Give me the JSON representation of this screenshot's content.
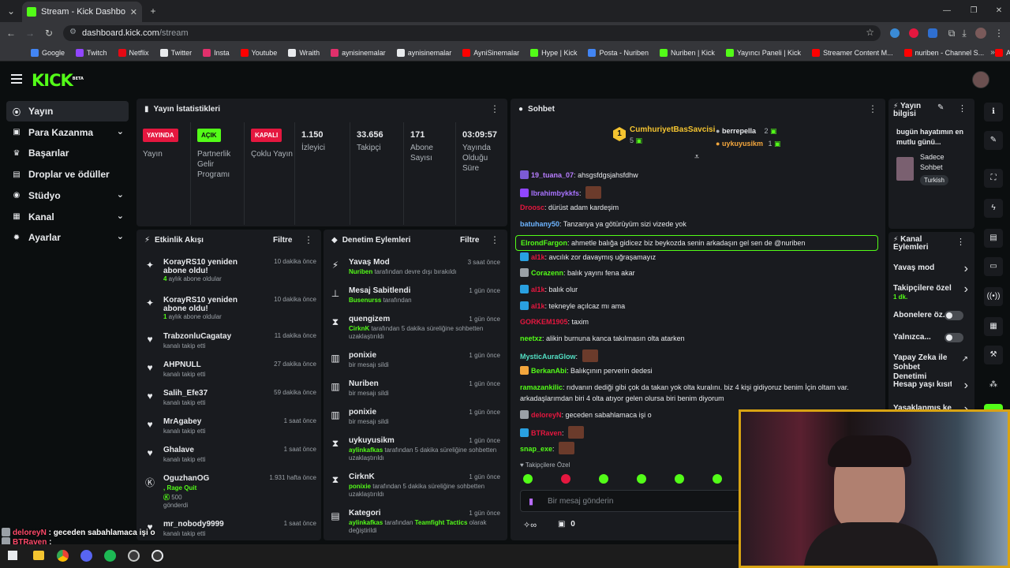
{
  "browser": {
    "tab_title": "Stream - Kick Dashboard",
    "url_host": "dashboard.kick.com",
    "url_path": "/stream",
    "bookmarks": [
      {
        "label": "Google",
        "color": "#4285f4"
      },
      {
        "label": "Twitch",
        "color": "#9146ff"
      },
      {
        "label": "Netflix",
        "color": "#e50914"
      },
      {
        "label": "Twitter",
        "color": "#e8eaed"
      },
      {
        "label": "Insta",
        "color": "#e1306c"
      },
      {
        "label": "Youtube",
        "color": "#ff0000"
      },
      {
        "label": "Wraith",
        "color": "#e8eaed"
      },
      {
        "label": "aynisinemalar",
        "color": "#e1306c"
      },
      {
        "label": "aynisinemalar",
        "color": "#e8eaed"
      },
      {
        "label": "AyniSinemalar",
        "color": "#ff0000"
      },
      {
        "label": "Hype | Kick",
        "color": "#53fc18"
      },
      {
        "label": "Posta - Nuriben",
        "color": "#4285f4"
      },
      {
        "label": "Nuriben | Kick",
        "color": "#53fc18"
      },
      {
        "label": "Yayıncı Paneli | Kick",
        "color": "#53fc18"
      },
      {
        "label": "Streamer Content M...",
        "color": "#ff0000"
      },
      {
        "label": "nuriben - Channel S...",
        "color": "#ff0000"
      },
      {
        "label": "Aynı Sinemalar - Ça...",
        "color": "#ff0000"
      }
    ]
  },
  "brand": {
    "logo": "KICK",
    "beta": "BETA",
    "accent": "#53fc18"
  },
  "sidebar": {
    "items": [
      {
        "label": "Yayın",
        "icon": "broadcast-icon",
        "active": true
      },
      {
        "label": "Para Kazanma",
        "icon": "money-icon",
        "chevron": true
      },
      {
        "label": "Başarılar",
        "icon": "trophy-icon"
      },
      {
        "label": "Droplar ve ödüller",
        "icon": "gift-icon"
      },
      {
        "label": "Stüdyo",
        "icon": "studio-icon",
        "chevron": true
      },
      {
        "label": "Kanal",
        "icon": "channel-icon",
        "chevron": true
      },
      {
        "label": "Ayarlar",
        "icon": "gear-icon",
        "chevron": true
      }
    ]
  },
  "stats": {
    "title": "Yayın İstatistikleri",
    "badges": [
      {
        "badge": "YAYINDA",
        "label": "Yayın",
        "bg": "#e5173f",
        "fg": "#ffffff"
      },
      {
        "badge": "AÇIK",
        "label": "Partnerlik Gelir Programı",
        "bg": "#53fc18",
        "fg": "#0b0e0f"
      },
      {
        "badge": "KAPALI",
        "label": "Çoklu Yayın",
        "bg": "#e5173f",
        "fg": "#ffffff"
      }
    ],
    "values": [
      {
        "value": "1.150",
        "label": "İzleyici"
      },
      {
        "value": "33.656",
        "label": "Takipçi"
      },
      {
        "value": "171",
        "label": "Abone Sayısı"
      },
      {
        "value": "03:09:57",
        "label": "Yayında Olduğu Süre"
      }
    ]
  },
  "activity": {
    "title": "Etkinlik Akışı",
    "filter": "Filtre",
    "items": [
      {
        "name": "KorayRS10 yeniden abone oldu!",
        "time": "10 dakika önce",
        "sub_num": "4",
        "sub": " aylık abone oldular",
        "icon": "sparkle-icon"
      },
      {
        "name": "KorayRS10 yeniden abone oldu!",
        "time": "10 dakika önce",
        "sub_num": "1",
        "sub": " aylık abone oldular",
        "icon": "sparkle-icon"
      },
      {
        "name": "TrabzonluCagatay",
        "time": "11 dakika önce",
        "sub": "kanalı takip etti",
        "icon": "heart-icon"
      },
      {
        "name": "AHPNULL",
        "time": "27 dakika önce",
        "sub": "kanalı takip etti",
        "icon": "heart-icon"
      },
      {
        "name": "Salih_Efe37",
        "time": "59 dakika önce",
        "sub": "kanalı takip etti",
        "icon": "heart-icon"
      },
      {
        "name": "MrAgabey",
        "time": "1 saat önce",
        "sub": "kanalı takip etti",
        "icon": "heart-icon"
      },
      {
        "name": "Ghalave",
        "time": "1 saat önce",
        "sub": "kanalı takip etti",
        "icon": "heart-icon"
      },
      {
        "name": "OguzhanOG",
        "time": "1.931 hafta önce",
        "sub_green": ", Rage Quit",
        "amount": "500",
        "sub2": "gönderdi",
        "icon": "kick-coin-icon"
      },
      {
        "name": "mr_nobody9999",
        "time": "1 saat önce",
        "sub": "kanalı takip etti",
        "icon": "heart-icon"
      }
    ]
  },
  "modlog": {
    "title": "Denetim Eylemleri",
    "filter": "Filtre",
    "items": [
      {
        "name": "Yavaş Mod",
        "time": "3 saat önce",
        "actor": "Nuriben",
        "desc": " tarafından devre dışı bırakıldı",
        "icon": "slow-icon"
      },
      {
        "name": "Mesaj Sabitlendi",
        "time": "1 gün önce",
        "actor": "Busenurss",
        "desc": " tarafından",
        "icon": "pin-icon"
      },
      {
        "name": "quengizem",
        "time": "1 gün önce",
        "actor": "CirknK",
        "desc": " tarafından 5 dakika süreliğine sohbetten uzaklaştırıldı",
        "icon": "hourglass-icon"
      },
      {
        "name": "ponixie",
        "time": "1 gün önce",
        "actor": "",
        "desc": "bir mesajı sildi",
        "icon": "trash-icon"
      },
      {
        "name": "Nuriben",
        "time": "1 gün önce",
        "actor": "",
        "desc": "bir mesajı sildi",
        "icon": "trash-icon"
      },
      {
        "name": "ponixie",
        "time": "1 gün önce",
        "actor": "",
        "desc": "bir mesajı sildi",
        "icon": "trash-icon"
      },
      {
        "name": "uykuyusikm",
        "time": "1 gün önce",
        "actor": "aylinkafkas",
        "desc": " tarafından 5 dakika süreliğine sohbetten uzaklaştırıldı",
        "icon": "hourglass-icon"
      },
      {
        "name": "CirknK",
        "time": "1 gün önce",
        "actor": "ponixie",
        "desc": " tarafından 5 dakika süreliğine sohbetten uzaklaştırıldı",
        "icon": "hourglass-icon"
      },
      {
        "name": "Kategori",
        "time": "1 gün önce",
        "actor": "aylinkafkas",
        "desc": " tarafından ",
        "highlight": "Teamfight Tactics",
        "desc2": " olarak değiştirildi",
        "icon": "category-icon"
      }
    ]
  },
  "chat": {
    "title": "Sohbet",
    "top_gifter": {
      "rank": "1",
      "name": "CumhuriyetBasSavcisi",
      "count": "5"
    },
    "gifters": [
      {
        "name": "berrepella",
        "count": "2",
        "color": "#e8eaed"
      },
      {
        "name": "uykuyusikm",
        "count": "1",
        "color": "#f4a73d"
      }
    ],
    "messages": [
      {
        "user": "19_tuana_07",
        "color": "#b87dff",
        "badge": "#7b5bd6",
        "text": "ahsgsfdgsjahsfdhw"
      },
      {
        "user": "Ibrahimbykkfs",
        "color": "#a873ff",
        "badge": "#9146ff",
        "text": "",
        "emote": true
      },
      {
        "user": "Droosc",
        "color": "#e5173f",
        "text": "dürüst adam kardeşim"
      },
      {
        "user": "batuhany50",
        "color": "#6db4ff",
        "text": "Tanzanya ya götürüyüm sizi vizede yok"
      },
      {
        "user": "ElrondFargon",
        "color": "#53fc18",
        "text": "ahmetle balığa gidicez biz beykozda senin arkadaşın gel sen de @nuriben",
        "pinned": true
      },
      {
        "user": "al1k",
        "color": "#e5173f",
        "badge": "#29a0e0",
        "text": "avcılık zor davaymış uğraşamayız"
      },
      {
        "user": "Corazenn",
        "color": "#53fc18",
        "badge": "#9aa0a6",
        "text": "balık yayını fena akar"
      },
      {
        "user": "al1k",
        "color": "#e5173f",
        "badge": "#29a0e0",
        "text": "balık olur"
      },
      {
        "user": "al1k",
        "color": "#e5173f",
        "badge": "#29a0e0",
        "text": "tekneyle açılcaz mı ama"
      },
      {
        "user": "GORKEM1905",
        "color": "#e5173f",
        "text": "taxim"
      },
      {
        "user": "neetxz",
        "color": "#53fc18",
        "text": "alikin burnuna kanca takılmasın olta atarken"
      },
      {
        "user": "MysticAuraGlow",
        "color": "#53e0c5",
        "text": "",
        "emote": true
      },
      {
        "user": "BerkanAbi",
        "color": "#53fc18",
        "badge": "#f4a73d",
        "text": "Balıkçının perverin dedesi"
      },
      {
        "user": "ramazankilic",
        "color": "#53fc18",
        "text": "rıdvanın dediği gibi çok da takan yok olta kuralını. biz 4 kişi gidiyoruz benim İçin oltam var."
      },
      {
        "user": "",
        "color": "#e8eaed",
        "text": "arkadaşlarımdan biri 4 olta atıyor gelen olursa biri benim diyorum"
      },
      {
        "user": "deloreyN",
        "color": "#e5173f",
        "badge": "#9aa0a6",
        "text": "geceden sabahlamaca işi o"
      },
      {
        "user": "BTRaven",
        "color": "#e5173f",
        "badge": "#29a0e0",
        "text": "",
        "emote": true
      },
      {
        "user": "snap_exe",
        "color": "#53fc18",
        "text": "",
        "emote": true
      }
    ],
    "followers_mode": "Takipçilere Özel",
    "input_placeholder": "Bir mesaj gönderin",
    "points_count": "0"
  },
  "stream_info": {
    "title": "Yayın bilgisi",
    "stream_title": "bugün hayatımın en mutlu günü...",
    "category": "Sadece Sohbet",
    "tag": "Turkish"
  },
  "channel_actions": {
    "title": "Kanal Eylemleri",
    "items": [
      {
        "label": "Yavaş mod",
        "kind": "chevron"
      },
      {
        "label": "Takipçilere özel s",
        "sub": "1 dk.",
        "kind": "chevron"
      },
      {
        "label": "Abonelere öz...",
        "kind": "toggle"
      },
      {
        "label": "Yalnızca...",
        "kind": "toggle"
      },
      {
        "label": "Yapay Zeka ile Sohbet Denetimi",
        "kind": "external"
      },
      {
        "label": "Hesap yaşı kısıtla",
        "kind": "chevron"
      },
      {
        "label": "Yasaklanmış kelin",
        "kind": "chevron"
      }
    ]
  },
  "overlay_chat": [
    {
      "user": "deloreyN",
      "text": "geceden sabahlamaca işi o"
    },
    {
      "user": "BTRaven",
      "text": ""
    },
    {
      "user": "snap_exe",
      "text": ""
    }
  ]
}
